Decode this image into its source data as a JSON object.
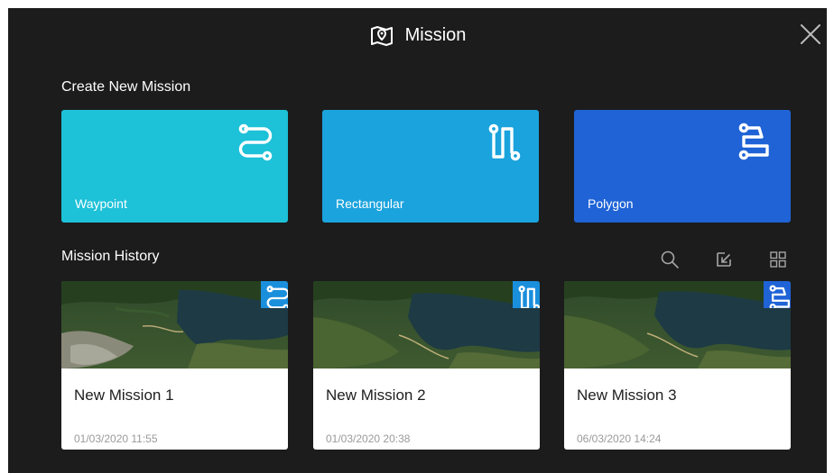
{
  "header": {
    "title": "Mission",
    "title_icon": "map-pin-icon",
    "close_icon": "close-icon"
  },
  "create_section": {
    "label": "Create New Mission",
    "cards": [
      {
        "label": "Waypoint",
        "icon": "waypoint-route-icon",
        "color": "#1dc1d8"
      },
      {
        "label": "Rectangular",
        "icon": "rectangular-route-icon",
        "color": "#1ba3dd"
      },
      {
        "label": "Polygon",
        "icon": "polygon-route-icon",
        "color": "#1f63d6"
      }
    ]
  },
  "history_section": {
    "label": "Mission History",
    "tools": [
      "search-icon",
      "select-icon",
      "grid-view-icon"
    ],
    "items": [
      {
        "title": "New Mission 1",
        "date": "01/03/2020 11:55",
        "type_icon": "waypoint-route-icon"
      },
      {
        "title": "New Mission 2",
        "date": "01/03/2020 20:38",
        "type_icon": "rectangular-route-icon"
      },
      {
        "title": "New Mission 3",
        "date": "06/03/2020 14:24",
        "type_icon": "polygon-route-icon"
      }
    ]
  },
  "colors": {
    "background": "#1c1c1c",
    "card_text": "#1e1e1e",
    "date_text": "#9a9a9a"
  }
}
